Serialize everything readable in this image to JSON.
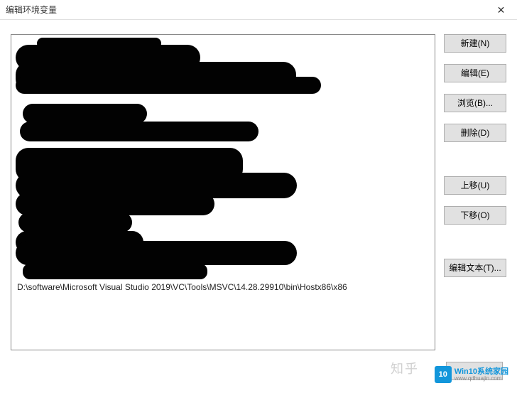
{
  "dialog": {
    "title": "编辑环境变量",
    "close_label": "✕"
  },
  "list": {
    "visible_entry": "D:\\software\\Microsoft Visual Studio 2019\\VC\\Tools\\MSVC\\14.28.29910\\bin\\Hostx86\\x86"
  },
  "buttons": {
    "new": "新建(N)",
    "edit": "编辑(E)",
    "browse": "浏览(B)...",
    "delete": "删除(D)",
    "move_up": "上移(U)",
    "move_down": "下移(O)",
    "edit_text": "编辑文本(T)..."
  },
  "footer": {
    "label": ""
  },
  "watermark": {
    "faint_text": "知乎",
    "logo_badge": "10",
    "logo_line1": "Win10系统家园",
    "logo_line2": "www.qdhuajin.com"
  }
}
